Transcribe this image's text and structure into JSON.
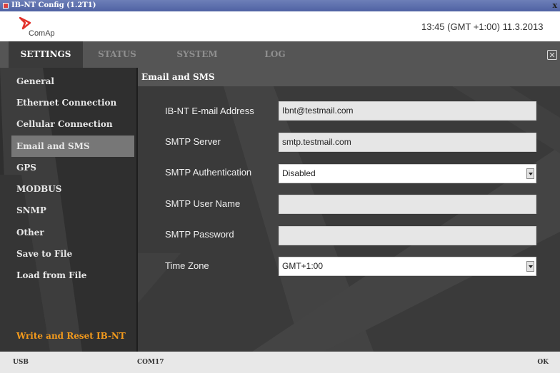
{
  "window": {
    "title": "IB-NT Config (1.2T1)",
    "close": "x"
  },
  "header": {
    "brand": "ComAp",
    "datetime": "13:45 (GMT +1:00) 11.3.2013"
  },
  "tabs": [
    {
      "label": "SETTINGS"
    },
    {
      "label": "STATUS"
    },
    {
      "label": "SYSTEM"
    },
    {
      "label": "LOG"
    }
  ],
  "sidebar": {
    "items": [
      {
        "label": "General"
      },
      {
        "label": "Ethernet Connection"
      },
      {
        "label": "Cellular Connection"
      },
      {
        "label": "Email and SMS"
      },
      {
        "label": "GPS"
      },
      {
        "label": "MODBUS"
      },
      {
        "label": "SNMP"
      },
      {
        "label": "Other"
      },
      {
        "label": "Save to File"
      },
      {
        "label": "Load from File"
      }
    ],
    "write_reset": "Write and Reset IB-NT"
  },
  "section": {
    "title": "Email and SMS"
  },
  "form": {
    "email": {
      "label": "IB-NT E-mail Address",
      "value": "Ibnt@testmail.com"
    },
    "smtp_server": {
      "label": "SMTP Server",
      "value": "smtp.testmail.com"
    },
    "smtp_auth": {
      "label": "SMTP Authentication",
      "value": "Disabled"
    },
    "smtp_user": {
      "label": "SMTP User Name",
      "value": ""
    },
    "smtp_password": {
      "label": "SMTP Password",
      "value": ""
    },
    "time_zone": {
      "label": "Time Zone",
      "value": "GMT+1:00"
    }
  },
  "status": {
    "left": "USB",
    "port": "COM17",
    "right": "OK"
  },
  "colors": {
    "accent": "#f39a1c",
    "brand_red": "#e2322b",
    "tab_bar": "#555555",
    "panel": "#3a3a3a"
  }
}
